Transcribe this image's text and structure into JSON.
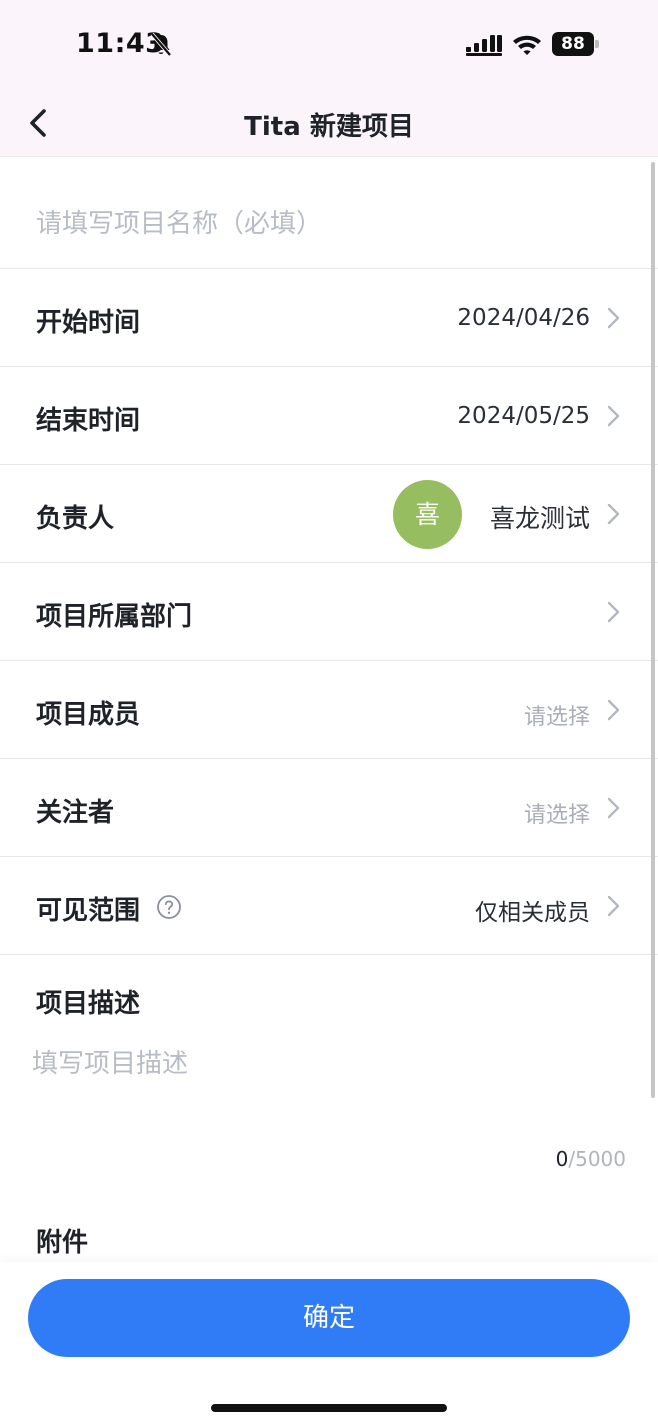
{
  "status_bar": {
    "time": "11:43",
    "battery": "88"
  },
  "nav": {
    "title": "Tita 新建项目"
  },
  "form": {
    "name_placeholder": "请填写项目名称（必填）",
    "rows": [
      {
        "label": "开始时间",
        "value": "2024/04/26"
      },
      {
        "label": "结束时间",
        "value": "2024/05/25"
      },
      {
        "label": "负责人",
        "value": "喜龙测试",
        "avatar_text": "喜",
        "avatar_color": "#96bd5f"
      },
      {
        "label": "项目所属部门",
        "value": ""
      },
      {
        "label": "项目成员",
        "value": "请选择"
      },
      {
        "label": "关注者",
        "value": "请选择"
      },
      {
        "label": "可见范围",
        "value": "仅相关成员"
      }
    ],
    "description": {
      "label": "项目描述",
      "placeholder": "填写项目描述",
      "count_current": "0",
      "count_max": "/5000"
    },
    "attachment_label": "附件"
  },
  "footer": {
    "confirm_label": "确定"
  },
  "colors": {
    "primary": "#2f7cf6",
    "header_bg": "#fcf4fb",
    "placeholder": "#b8bcc4"
  }
}
